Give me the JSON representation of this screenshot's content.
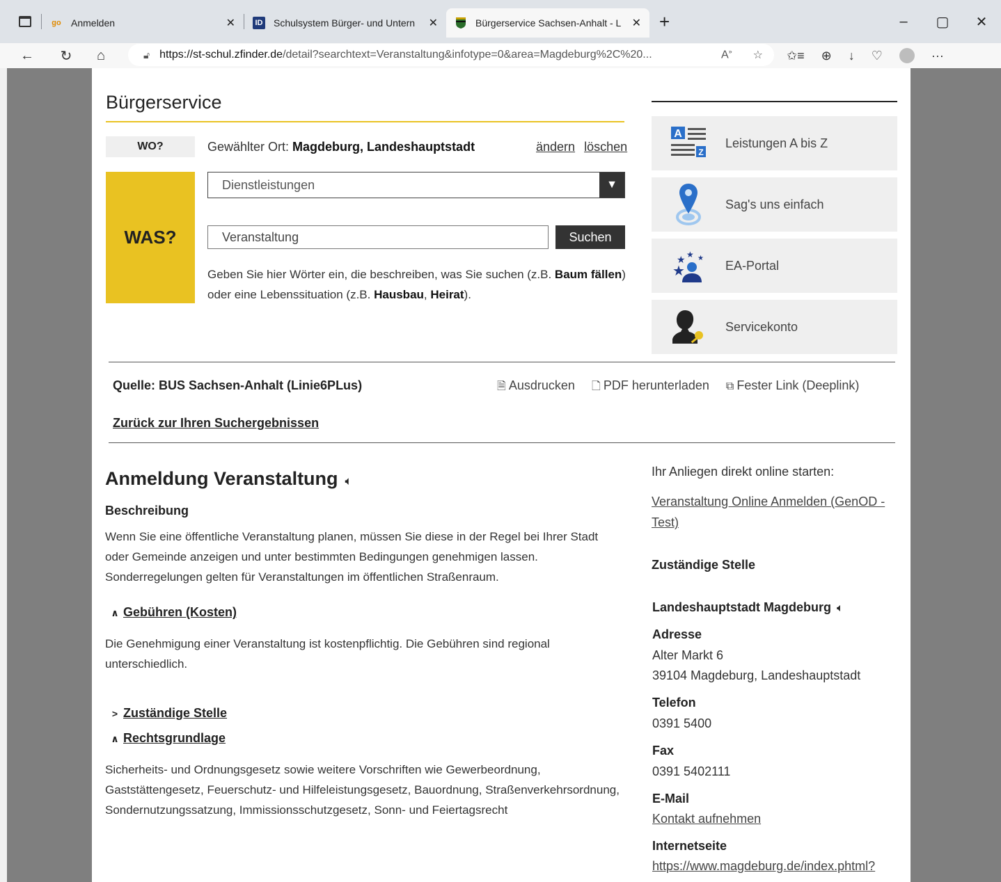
{
  "browser": {
    "tabs": [
      {
        "favicon": "go",
        "title": "Anmelden",
        "close": "✕"
      },
      {
        "favicon": "ID",
        "title": "Schulsystem Bürger- und Untern",
        "close": "✕"
      },
      {
        "favicon": "coat-of-arms",
        "title": "Bürgerservice Sachsen-Anhalt - L",
        "close": "✕"
      }
    ],
    "new_tab": "+",
    "url_host": "https://st-schul.zfinder.de",
    "url_path": "/detail?searchtext=Veranstaltung&infotype=0&area=Magdeburg%2C%20..."
  },
  "header": {
    "title": "Bürgerservice",
    "wo_label": "WO?",
    "ort_prefix": "Gewählter Ort: ",
    "ort_value": "Magdeburg, Landeshauptstadt",
    "change_link": "ändern",
    "delete_link": "löschen",
    "was_label": "WAS?",
    "category_selected": "Dienstleistungen",
    "search_value": "Veranstaltung",
    "search_button": "Suchen",
    "hint": {
      "t1": "Geben Sie hier Wörter ein, die beschreiben, was Sie suchen (z.B. ",
      "b1": "Baum fällen",
      "t2": ") oder eine Lebenssituation (z.B. ",
      "b2": "Hausbau",
      "t3": ", ",
      "b3": "Heirat",
      "t4": ")."
    }
  },
  "sidebar": {
    "cards": [
      {
        "icon": "a-to-z-icon",
        "label": "Leistungen A bis Z"
      },
      {
        "icon": "location-pin-icon",
        "label": "Sag's uns einfach"
      },
      {
        "icon": "eu-stars-person-icon",
        "label": "EA-Portal"
      },
      {
        "icon": "user-key-icon",
        "label": "Servicekonto"
      }
    ]
  },
  "meta": {
    "quelle": "Quelle: BUS Sachsen-Anhalt (Linie6PLus)",
    "print": "Ausdrucken",
    "pdf": "PDF herunterladen",
    "deeplink": "Fester Link (Deeplink)",
    "back": "Zurück zur Ihren Suchergebnissen"
  },
  "main": {
    "title": "Anmeldung Veranstaltung",
    "desc_heading": "Beschreibung",
    "desc_text": "Wenn Sie eine öffentliche Veranstaltung planen, müssen Sie diese in der Regel bei Ihrer Stadt oder Gemeinde anzeigen und unter bestimmten  Bedingungen genehmigen lassen. Sonderregelungen gelten für Veranstaltungen im öffentlichen Straßenraum.",
    "sections": [
      {
        "chev": "∧",
        "label": "Gebühren (Kosten)",
        "expanded": true,
        "text": "Die Genehmigung einer Veranstaltung ist kostenpflichtig. Die Gebühren sind regional unterschiedlich."
      },
      {
        "chev": ">",
        "label": "Zuständige Stelle",
        "expanded": false,
        "text": ""
      },
      {
        "chev": "∧",
        "label": "Rechtsgrundlage",
        "expanded": true,
        "text": "Sicherheits- und Ordnungsgesetz sowie weitere Vorschriften wie Gewerbeordnung, Gaststättengesetz, Feuerschutz- und Hilfeleistungsgesetz, Bauordnung, Straßenverkehrsordnung, Sondernutzungssatzung, Immissionsschutzgesetz, Sonn- und Feiertagsrecht"
      }
    ]
  },
  "info": {
    "online_heading": "Ihr Anliegen direkt online starten:",
    "online_link": "Veranstaltung Online Anmelden (GenOD - Test)",
    "zust_heading": "Zuständige Stelle",
    "org_name": "Landeshauptstadt Magdeburg",
    "addr_label": "Adresse",
    "addr_line1": "Alter Markt 6",
    "addr_line2": "39104 Magdeburg, Landeshauptstadt",
    "tel_label": "Telefon",
    "tel_value": "0391 5400",
    "fax_label": "Fax",
    "fax_value": "0391 5402111",
    "mail_label": "E-Mail",
    "mail_link": "Kontakt aufnehmen",
    "web_label": "Internetseite",
    "web_link": "https://www.magdeburg.de/index.phtml?"
  },
  "colors": {
    "accent_yellow": "#e9c222",
    "dark": "#333333",
    "card_bg": "#efefef"
  }
}
